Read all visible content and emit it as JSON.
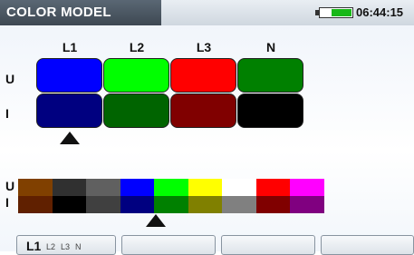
{
  "header": {
    "title": "COLOR MODEL",
    "time": "06:44:15",
    "battery_level": 0.65
  },
  "phases": [
    "L1",
    "L2",
    "L3",
    "N"
  ],
  "row_labels": {
    "voltage": "U",
    "current": "I"
  },
  "voltage_colors": [
    "#0000ff",
    "#00ff00",
    "#ff0000",
    "#008000"
  ],
  "current_colors": [
    "#000080",
    "#006400",
    "#800000",
    "#000000"
  ],
  "selected_phase": "L1",
  "palette": {
    "row_labels": {
      "voltage": "U",
      "current": "I"
    },
    "top": [
      "#804000",
      "#303030",
      "#606060",
      "#0000ff",
      "#00ff00",
      "#ffff00",
      "#ffffff",
      "#ff0000",
      "#ff00ff"
    ],
    "bottom": [
      "#602000",
      "#000000",
      "#404040",
      "#000080",
      "#008000",
      "#808000",
      "#808080",
      "#800000",
      "#800080"
    ],
    "selected_index": 3
  },
  "softkeys": {
    "key1": {
      "active": "L1",
      "options": [
        "L2",
        "L3",
        "N"
      ]
    },
    "key2": "",
    "key3": "",
    "key4": ""
  }
}
